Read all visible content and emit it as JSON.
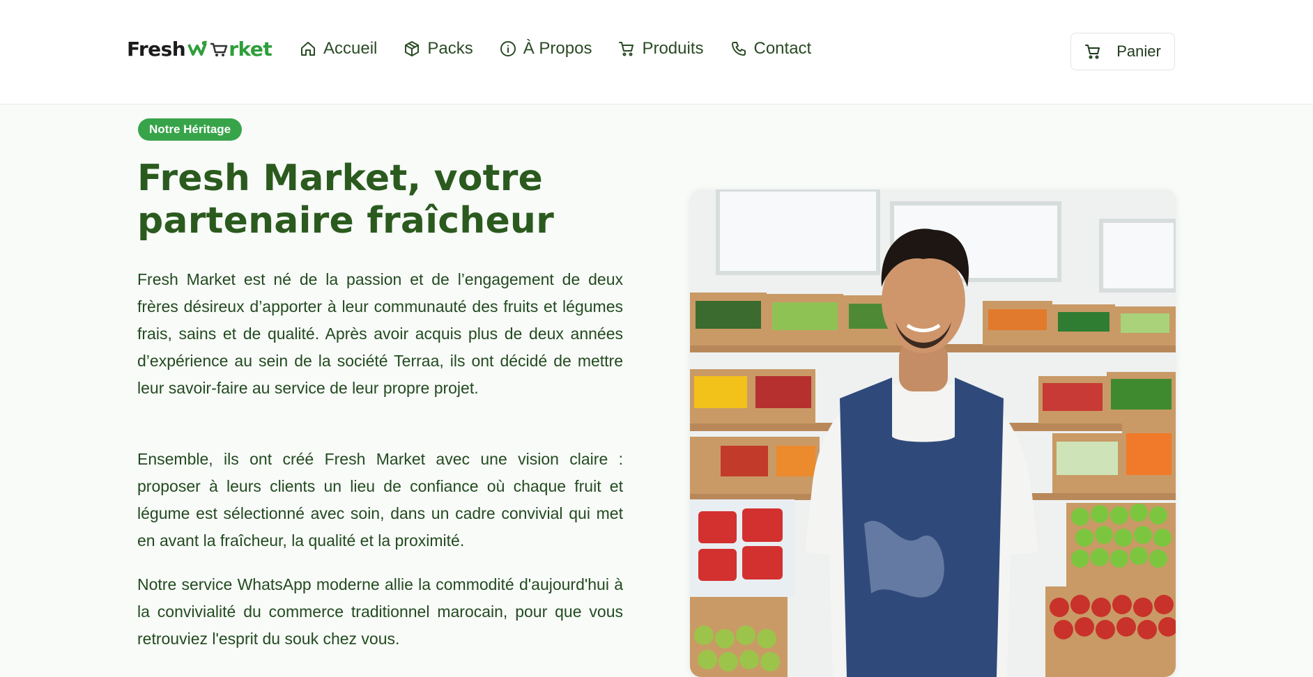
{
  "header": {
    "logo": {
      "part1": "Fresh",
      "part2": "rket",
      "icon": "leaf-check-cart-logo"
    },
    "nav": [
      {
        "label": "Accueil",
        "icon": "home-icon"
      },
      {
        "label": "Packs",
        "icon": "package-icon"
      },
      {
        "label": "À Propos",
        "icon": "info-icon"
      },
      {
        "label": "Produits",
        "icon": "cart-icon"
      },
      {
        "label": "Contact",
        "icon": "phone-icon"
      }
    ],
    "cart_button": {
      "label": "Panier",
      "icon": "cart-icon"
    }
  },
  "about": {
    "badge": "Notre Héritage",
    "title": "Fresh Market, votre partenaire fraîcheur",
    "paragraphs": [
      "Fresh Market est né de la passion et de l’engagement de deux frères désireux d’apporter à leur communauté des fruits et légumes frais, sains et de qualité. Après avoir acquis plus de deux années d’expérience au sein de la société Terraa, ils ont décidé de mettre leur savoir-faire au service de leur propre projet.",
      "Ensemble, ils ont créé Fresh Market avec une vision claire : proposer à leurs clients un lieu de confiance où chaque fruit et légume est sélectionné avec soin, dans un cadre convivial qui met en avant la fraîcheur, la qualité et la proximité.",
      "Notre service WhatsApp moderne allie la commodité d'aujourd'hui à la convivialité du commerce traditionnel marocain, pour que vous retrouviez l'esprit du souk chez vous."
    ]
  },
  "colors": {
    "accent": "#38a44a",
    "heading": "#2b5a1e",
    "text": "#234a20",
    "background": "#f8fbf8"
  }
}
